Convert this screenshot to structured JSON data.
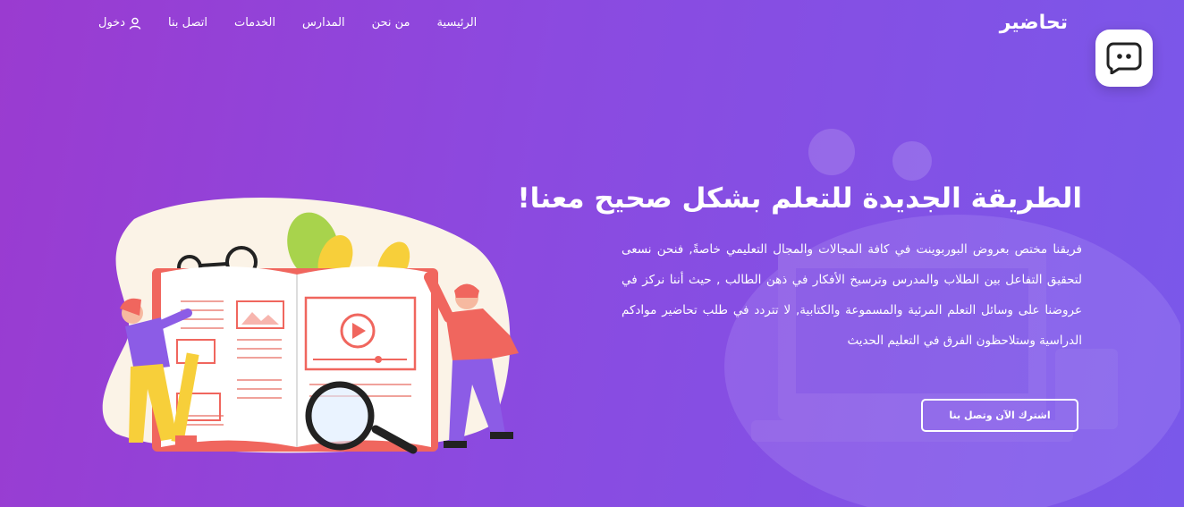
{
  "nav": {
    "brand": "تحاضير",
    "links": [
      "الرئيسية",
      "من نحن",
      "المدارس",
      "الخدمات",
      "اتصل بنا"
    ],
    "login": "دخول"
  },
  "hero": {
    "title": "الطريقة الجديدة للتعلم بشكل صحيح معنا!",
    "text": "فريقنا مختص بعروض البوربوينت في كافة المجالات والمجال التعليمي خاصةً, فنحن نسعى لتحقيق التفاعل بين الطلاب والمدرس وترسيخ الأفكار في ذهن الطالب , حيث أننا نركز في عروضنا على وسائل التعلم المرئية والمسموعة والكتابية, لا تتردد في طلب تحاضير موادكم الدراسية وستلاحظون الفرق في التعليم الحديث",
    "cta": "اشترك الآن وتصل بنا"
  },
  "icons": {
    "login": "user-icon",
    "chat": "chat-bubble-icon"
  },
  "colors": {
    "gradient_start": "#9a3bd0",
    "gradient_end": "#7a58ea",
    "book_red": "#f0665e",
    "person_yellow": "#f7cf3a"
  }
}
